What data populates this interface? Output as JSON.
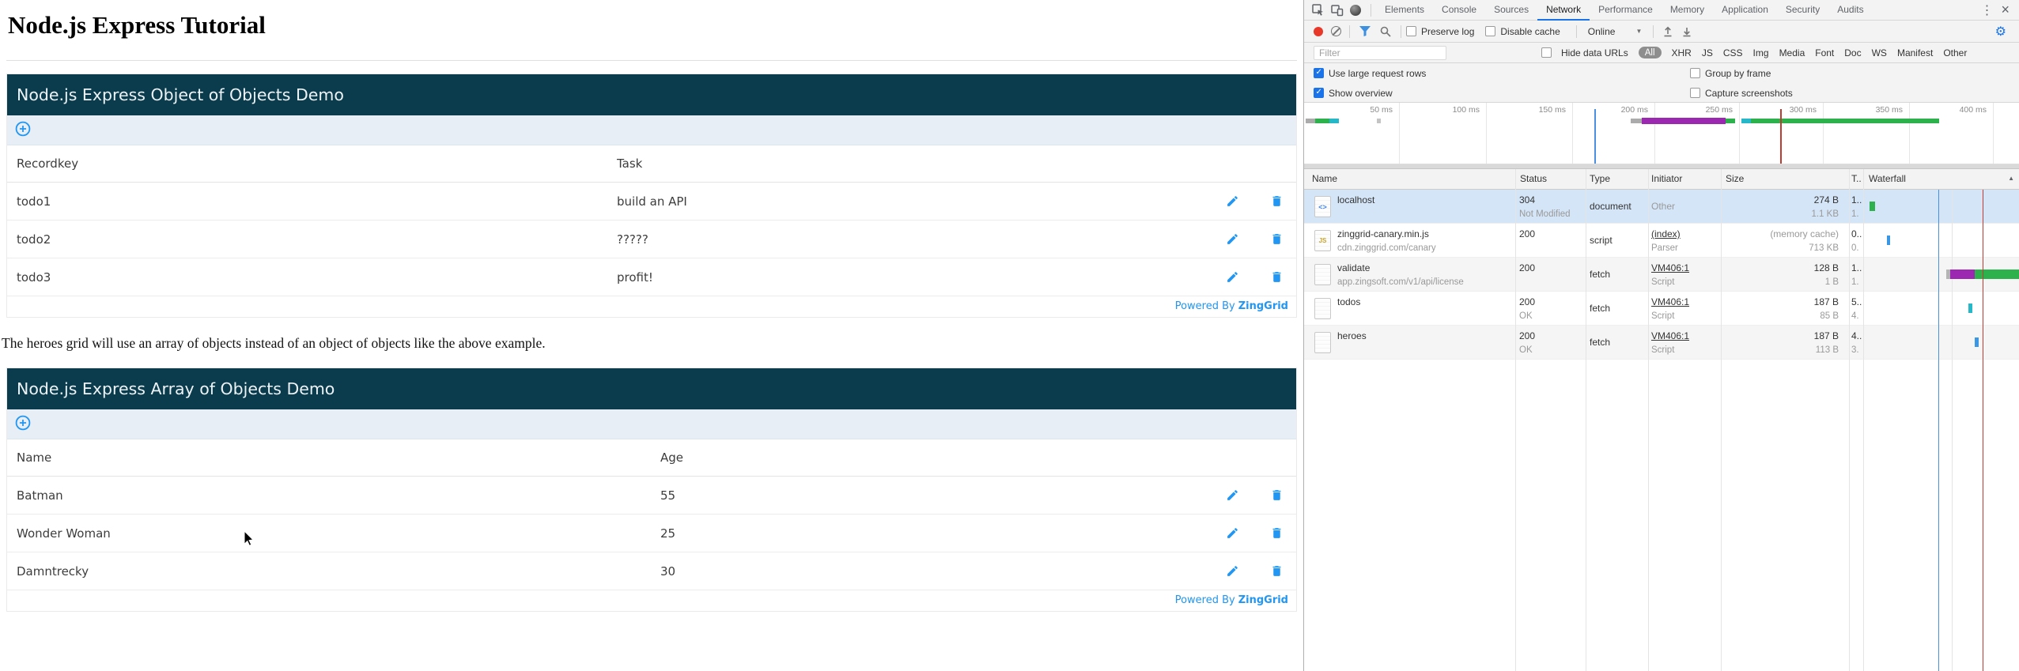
{
  "page": {
    "title": "Node.js Express Tutorial",
    "note": "The heroes grid will use an array of objects instead of an object of objects like the above example.",
    "grids": [
      {
        "caption": "Node.js Express Object of Objects Demo",
        "col1": "Recordkey",
        "col2": "Task",
        "rows": [
          {
            "c1": "todo1",
            "c2": "build an API"
          },
          {
            "c1": "todo2",
            "c2": "?????"
          },
          {
            "c1": "todo3",
            "c2": "profit!"
          }
        ],
        "footer": {
          "prefix": "Powered By",
          "brand": "ZingGrid"
        }
      },
      {
        "caption": "Node.js Express Array of Objects Demo",
        "col1": "Name",
        "col2": "Age",
        "rows": [
          {
            "c1": "Batman",
            "c2": "55"
          },
          {
            "c1": "Wonder Woman",
            "c2": "25"
          },
          {
            "c1": "Damntrecky",
            "c2": "30"
          }
        ],
        "footer": {
          "prefix": "Powered By",
          "brand": "ZingGrid"
        }
      }
    ],
    "colors": {
      "caption_bg": "#0b3c4d",
      "zinggrid_blue": "#2196f3"
    }
  },
  "devtools": {
    "tabs": [
      "Elements",
      "Console",
      "Sources",
      "Network",
      "Performance",
      "Memory",
      "Application",
      "Security",
      "Audits"
    ],
    "active_tab": "Network",
    "icons": {
      "more": "⋮",
      "close": "×",
      "dropdown": "▼",
      "sort_asc": "▲",
      "gear": "⚙"
    },
    "controls": {
      "preserve_log": "Preserve log",
      "disable_cache": "Disable cache",
      "throttling": "Online"
    },
    "filter_bar": {
      "placeholder": "Filter",
      "hide_data_urls": "Hide data URLs",
      "types": [
        "All",
        "XHR",
        "JS",
        "CSS",
        "Img",
        "Media",
        "Font",
        "Doc",
        "WS",
        "Manifest",
        "Other"
      ],
      "active_type": "All"
    },
    "options": {
      "large_rows": "Use large request rows",
      "group_by_frame": "Group by frame",
      "show_overview": "Show overview",
      "capture_screenshots": "Capture screenshots"
    },
    "overview_ticks": [
      "50 ms",
      "100 ms",
      "150 ms",
      "200 ms",
      "250 ms",
      "300 ms",
      "350 ms",
      "400 ms"
    ],
    "table": {
      "headers": {
        "name": "Name",
        "status": "Status",
        "type": "Type",
        "initiator": "Initiator",
        "size": "Size",
        "time": "T..",
        "waterfall": "Waterfall"
      },
      "rows": [
        {
          "name": "localhost",
          "name_sub": "",
          "status": "304",
          "status_sub": "Not Modified",
          "type": "document",
          "initiator": "Other",
          "initiator_sub": "",
          "size": "274 B",
          "size_sub": "1.1 KB",
          "time": "1..",
          "time_sub": "1."
        },
        {
          "name": "zinggrid-canary.min.js",
          "name_sub": "cdn.zinggrid.com/canary",
          "status": "200",
          "status_sub": "",
          "type": "script",
          "initiator": "(index)",
          "initiator_sub": "Parser",
          "size": "(memory cache)",
          "size_sub": "713 KB",
          "time": "0..",
          "time_sub": "0."
        },
        {
          "name": "validate",
          "name_sub": "app.zingsoft.com/v1/api/license",
          "status": "200",
          "status_sub": "",
          "type": "fetch",
          "initiator": "VM406:1",
          "initiator_sub": "Script",
          "size": "128 B",
          "size_sub": "1 B",
          "time": "1..",
          "time_sub": "1."
        },
        {
          "name": "todos",
          "name_sub": "",
          "status": "200",
          "status_sub": "OK",
          "type": "fetch",
          "initiator": "VM406:1",
          "initiator_sub": "Script",
          "size": "187 B",
          "size_sub": "85 B",
          "time": "5..",
          "time_sub": "4."
        },
        {
          "name": "heroes",
          "name_sub": "",
          "status": "200",
          "status_sub": "OK",
          "type": "fetch",
          "initiator": "VM406:1",
          "initiator_sub": "Script",
          "size": "187 B",
          "size_sub": "113 B",
          "time": "4..",
          "time_sub": "3."
        }
      ]
    },
    "colors": {
      "accent_blue": "#1a73e8",
      "record_red": "#e8382a",
      "waterfall_green": "#2db14c",
      "waterfall_purple": "#9c27b0",
      "waterfall_teal": "#26b8c8",
      "waterfall_blue": "#3b97e3",
      "dom_line_blue": "#4a90e2",
      "load_line_red": "#c23a2f"
    }
  }
}
